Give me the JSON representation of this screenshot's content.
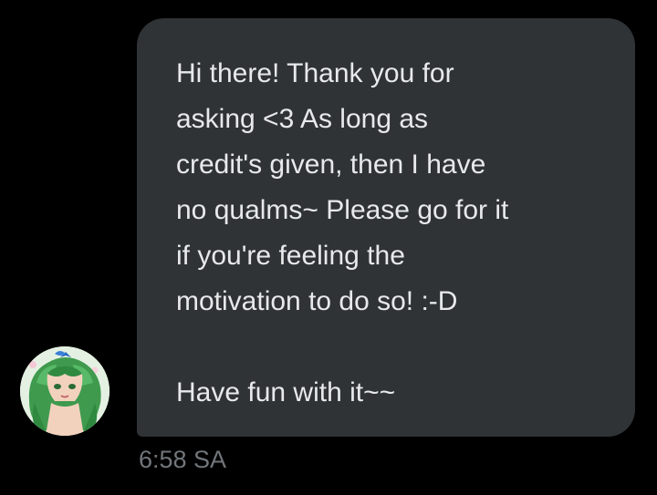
{
  "conversation": {
    "message": {
      "lines": [
        "Hi there! Thank you for",
        "asking <3 As long as",
        "credit's given, then I have",
        "no qualms~ Please go for it",
        "if you're feeling the",
        "motivation to do so! :-D"
      ],
      "closing": "Have fun with it~~",
      "timestamp": "6:58 SA"
    },
    "sender": {
      "avatar_icon": "sender-avatar-illustration"
    }
  },
  "colors": {
    "background": "#000000",
    "bubble": "#2f3336",
    "text": "#e7e9ea",
    "timestamp": "#71767b"
  }
}
